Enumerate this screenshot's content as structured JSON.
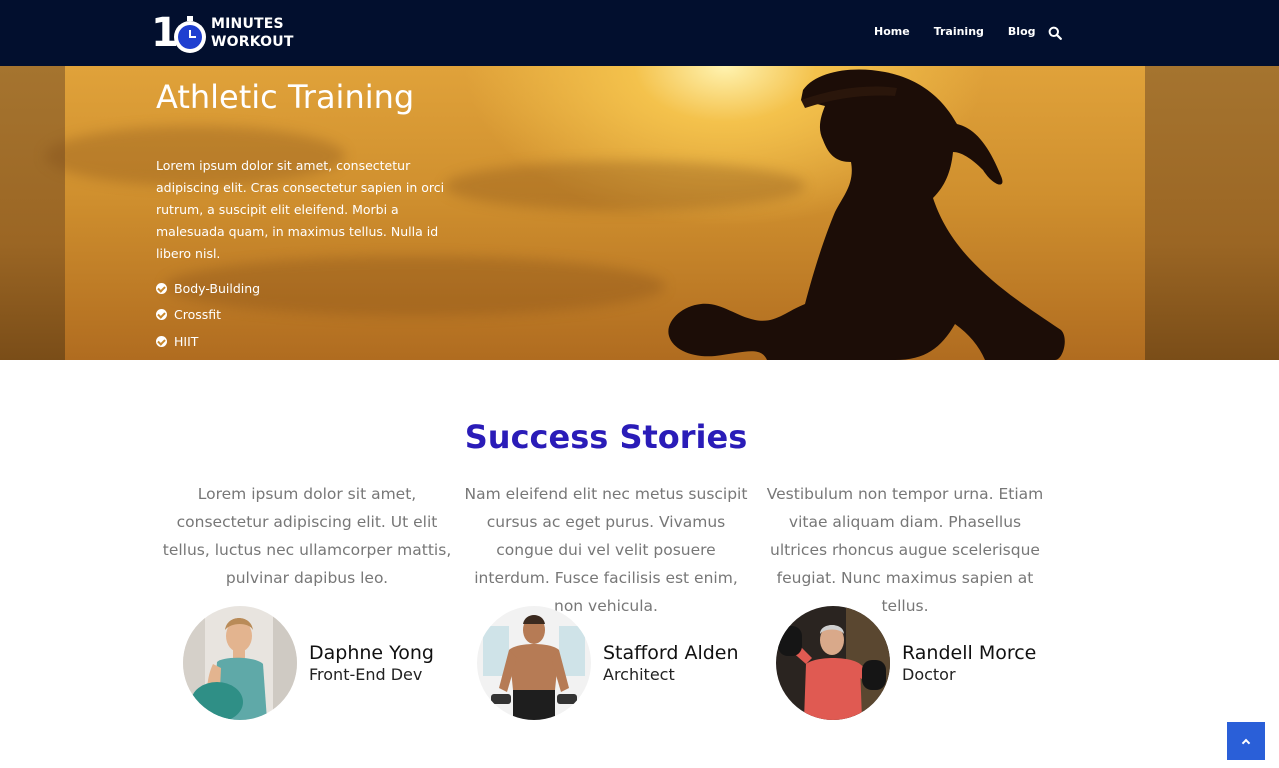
{
  "nav": {
    "logo_number": "1",
    "logo_line1": "MINUTES",
    "logo_line2": "WORKOUT",
    "links": [
      "Home",
      "Training",
      "Blog"
    ],
    "search_icon": "search-icon"
  },
  "hero": {
    "title": "Athletic Training",
    "text": "Lorem ipsum dolor sit amet, consectetur adipiscing elit. Cras consectetur sapien in orci rutrum, a suscipit elit eleifend. Morbi a malesuada quam, in maximus tellus. Nulla id libero nisl.",
    "list": [
      "Body-Building",
      "Crossfit",
      "HIIT"
    ]
  },
  "success": {
    "title": "Success Stories",
    "stories": [
      {
        "text": "Lorem ipsum dolor sit amet, consectetur adipiscing elit. Ut elit tellus, luctus nec ullamcorper mattis, pulvinar dapibus leo.",
        "name": "Daphne Yong",
        "role": "Front-End Dev"
      },
      {
        "text": "Nam eleifend elit nec metus suscipit cursus ac eget purus. Vivamus congue dui vel velit posuere interdum. Fusce facilisis est enim, non vehicula.",
        "name": "Stafford Alden",
        "role": "Architect"
      },
      {
        "text": "Vestibulum non tempor urna. Etiam vitae aliquam diam. Phasellus ultrices rhoncus augue scelerisque feugiat. Nunc maximus sapien at tellus.",
        "name": "Randell Morce",
        "role": "Doctor"
      }
    ]
  },
  "colors": {
    "navbar": "#020f2e",
    "accent_title": "#2a1cb8",
    "scroll_button": "#2a5fd8"
  },
  "scroll_top_icon": "chevron-up-icon"
}
